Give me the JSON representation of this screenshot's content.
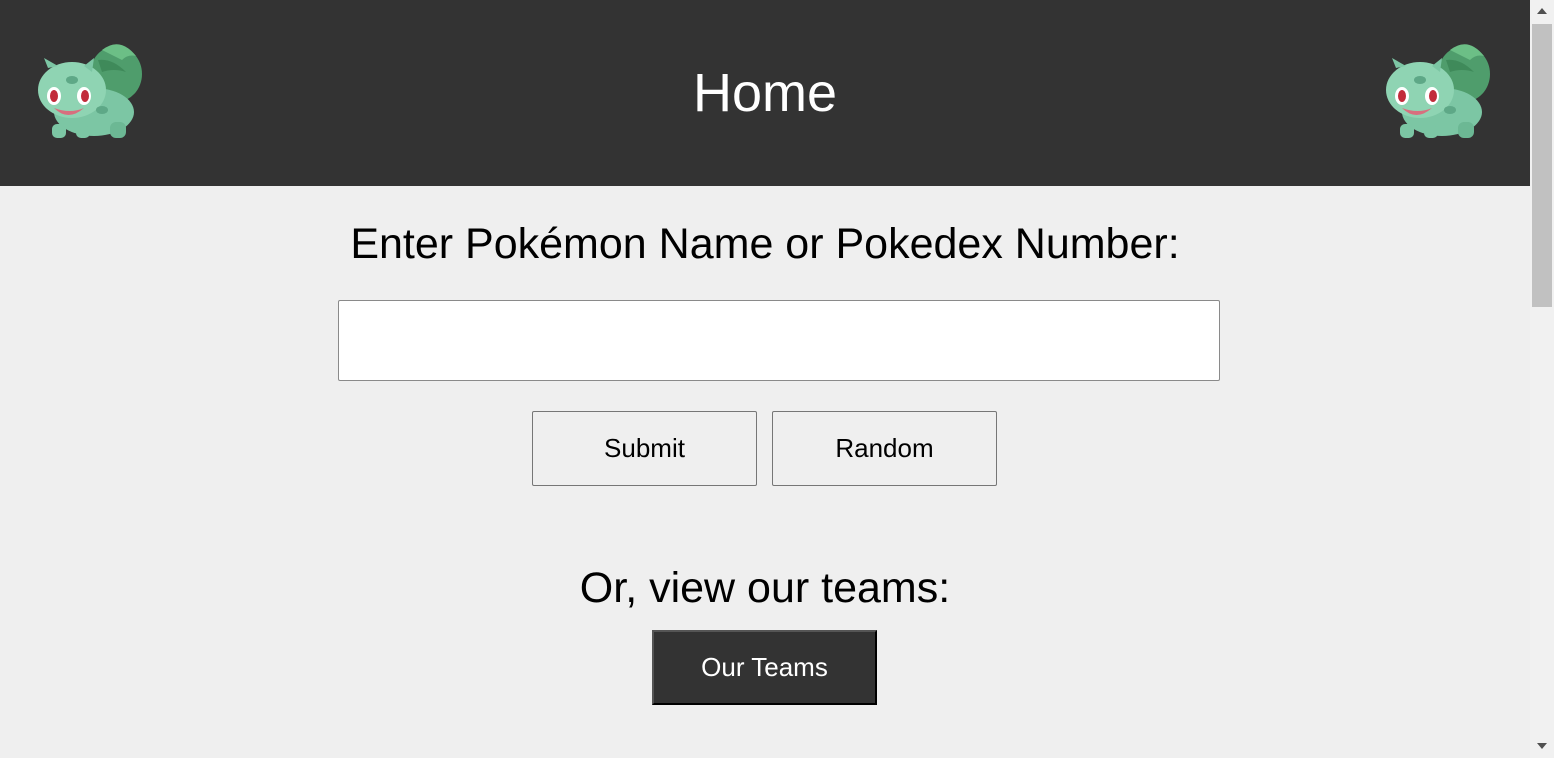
{
  "header": {
    "title": "Home",
    "mascot_icon": "bulbasaur-icon",
    "background": "#333333",
    "text_color": "#ffffff"
  },
  "search": {
    "prompt": "Enter Pokémon Name or Pokedex Number:",
    "input_value": "",
    "input_placeholder": ""
  },
  "buttons": {
    "submit_label": "Submit",
    "random_label": "Random"
  },
  "teams": {
    "prompt": "Or, view our teams:",
    "button_label": "Our Teams",
    "button_background": "#333333"
  },
  "page": {
    "background": "#efefef"
  }
}
